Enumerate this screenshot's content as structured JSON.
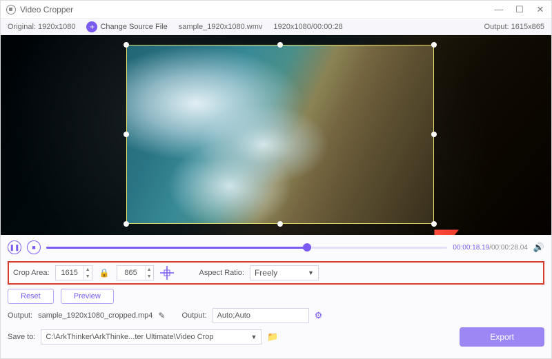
{
  "titlebar": {
    "title": "Video Cropper"
  },
  "infobar": {
    "original_label": "Original:",
    "original_value": "1920x1080",
    "change_source_label": "Change Source File",
    "filename": "sample_1920x1080.wmv",
    "source_info": "1920x1080/00:00:28",
    "output_label": "Output:",
    "output_value": "1615x865"
  },
  "player": {
    "time_current": "00:00:18.19",
    "time_total": "00:00:28.04"
  },
  "crop": {
    "area_label": "Crop Area:",
    "width": "1615",
    "height": "865",
    "aspect_label": "Aspect Ratio:",
    "aspect_value": "Freely"
  },
  "buttons": {
    "reset": "Reset",
    "preview": "Preview",
    "export": "Export"
  },
  "output": {
    "label1": "Output:",
    "filename": "sample_1920x1080_cropped.mp4",
    "label2": "Output:",
    "setting": "Auto;Auto"
  },
  "save": {
    "label": "Save to:",
    "path": "C:\\ArkThinker\\ArkThinke...ter Ultimate\\Video Crop"
  }
}
